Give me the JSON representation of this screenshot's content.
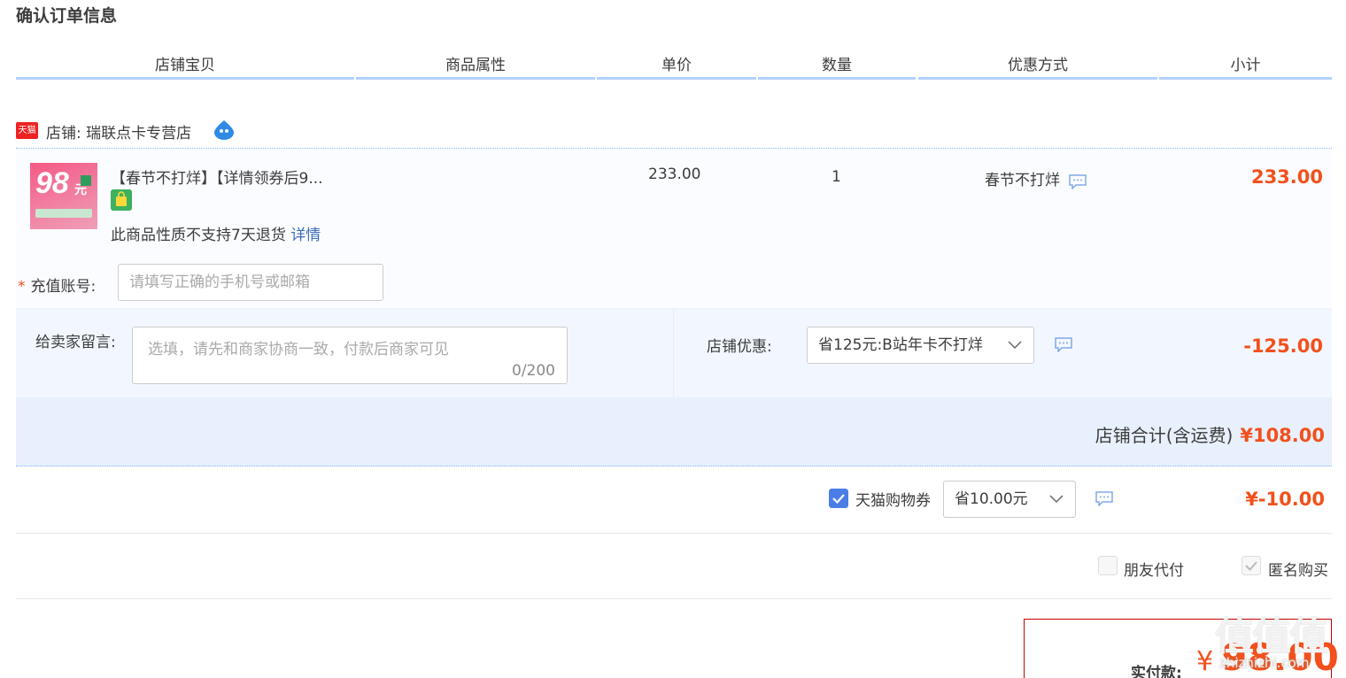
{
  "page_title": "确认订单信息",
  "columns": [
    "店铺宝贝",
    "商品属性",
    "单价",
    "数量",
    "优惠方式",
    "小计"
  ],
  "shop": {
    "logo": "天猫",
    "label": "店铺: 瑞联点卡专营店",
    "icon": "wangwang-chat-icon"
  },
  "item": {
    "thumb_big": "98",
    "thumb_unit": "元",
    "title": "【春节不打烊】【详情领券后9...",
    "notice": "此商品性质不支持7天退货",
    "notice_link": "详情",
    "price": "233.00",
    "quantity": "1",
    "promo": "春节不打烊",
    "subtotal": "233.00"
  },
  "account": {
    "star": "*",
    "label": "充值账号:",
    "placeholder": "请填写正确的手机号或邮箱"
  },
  "message": {
    "label": "给卖家留言:",
    "placeholder": "选填，请先和商家协商一致，付款后商家可见",
    "count": "0/200"
  },
  "shop_coupon": {
    "label": "店铺优惠:",
    "selected": "省125元:B站年卡不打烊",
    "amount": "-125.00"
  },
  "shop_total": {
    "label": "店铺合计(含运费)",
    "amount": "¥108.00"
  },
  "tmall_voucher": {
    "label": "天猫购物券",
    "checked": true,
    "selected": "省10.00元",
    "amount": "¥-10.00"
  },
  "options": {
    "friend_pay": "朋友代付",
    "anonymous": "匿名购买"
  },
  "final": {
    "label": "实付款:",
    "currency": "¥",
    "amount": "98.00"
  },
  "watermark": {
    "logo": "值值值",
    "url": "zhizhizhi.com"
  },
  "colors": {
    "accent": "#f2501c",
    "header_line": "#b2d1ff",
    "checkbox": "#4a7ee6"
  }
}
